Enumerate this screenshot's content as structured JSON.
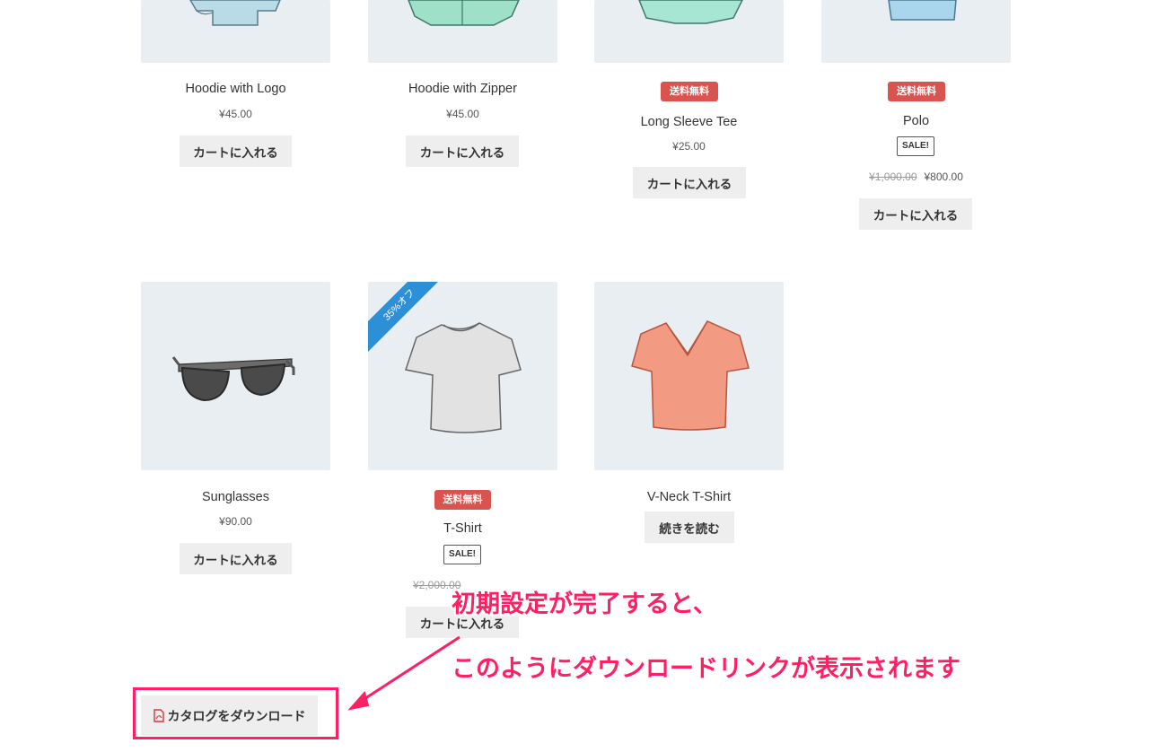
{
  "products": [
    {
      "name": "Hoodie with Logo",
      "price": "¥45.00",
      "button": "カートに入れる",
      "free_badge": "",
      "sale_badge": "",
      "old_price": ""
    },
    {
      "name": "Hoodie with Zipper",
      "price": "¥45.00",
      "button": "カートに入れる",
      "free_badge": "",
      "sale_badge": "",
      "old_price": ""
    },
    {
      "name": "Long Sleeve Tee",
      "price": "¥25.00",
      "button": "カートに入れる",
      "free_badge": "送料無料",
      "sale_badge": "",
      "old_price": ""
    },
    {
      "name": "Polo",
      "price": "¥800.00",
      "button": "カートに入れる",
      "free_badge": "送料無料",
      "sale_badge": "SALE!",
      "old_price": "¥1,000.00"
    },
    {
      "name": "Sunglasses",
      "price": "¥90.00",
      "button": "カートに入れる",
      "free_badge": "",
      "sale_badge": "",
      "old_price": ""
    },
    {
      "name": "T-Shirt",
      "price": "",
      "button": "カートに入れる",
      "free_badge": "送料無料",
      "sale_badge": "SALE!",
      "old_price": "¥2,000.00",
      "ribbon": "35%オフ"
    },
    {
      "name": "V-Neck T-Shirt",
      "price": "",
      "button": "続きを読む",
      "free_badge": "",
      "sale_badge": "",
      "old_price": ""
    }
  ],
  "download": {
    "label": "カタログをダウンロード",
    "icon": "pdf-icon"
  },
  "annotation": {
    "line1": "初期設定が完了すると、",
    "line2": "このようにダウンロードリンクが表示されます"
  },
  "colors": {
    "accent": "#ff1f63",
    "badge": "#d9534f",
    "ribbon": "#2d8fd5",
    "thumb_bg": "#e8eef2",
    "button_bg": "#eeeeee"
  }
}
